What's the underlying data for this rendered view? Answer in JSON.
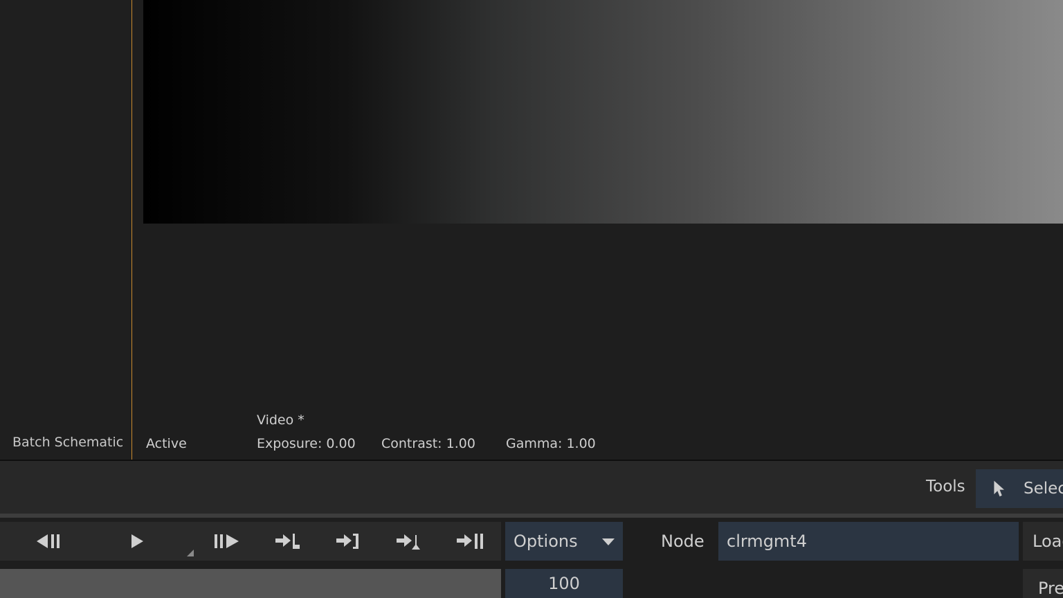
{
  "left_panel": {
    "label": "Batch Schematic"
  },
  "viewer": {
    "active_label": "Active",
    "video_label": "Video *",
    "exposure": "Exposure: 0.00",
    "contrast": "Contrast: 1.00",
    "gamma": "Gamma: 1.00"
  },
  "tools_bar": {
    "tools_label": "Tools",
    "select_label": "Select"
  },
  "transport": {
    "buttons": [
      {
        "name": "step-back-icon"
      },
      {
        "name": "play-icon"
      },
      {
        "name": "step-forward-icon"
      },
      {
        "name": "go-to-in-icon"
      },
      {
        "name": "go-to-out-icon"
      },
      {
        "name": "go-to-mark-icon"
      },
      {
        "name": "go-to-end-icon"
      }
    ]
  },
  "options": {
    "label": "Options"
  },
  "node": {
    "label": "Node",
    "value": "clrmgmt4"
  },
  "load": {
    "label": "Load"
  },
  "frame": {
    "value": "100"
  },
  "preview": {
    "label": "Preview"
  },
  "colors": {
    "accent_border": "#c98a2e",
    "field_bg": "#2b3542",
    "panel_bg": "#1e1e1e"
  }
}
